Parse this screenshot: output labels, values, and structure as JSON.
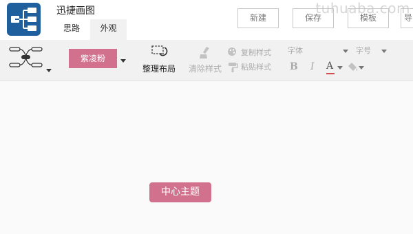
{
  "app": {
    "title": "迅捷画图"
  },
  "tabs": [
    {
      "label": "思路"
    },
    {
      "label": "外观"
    }
  ],
  "actions": {
    "new_label": "新建",
    "save_label": "保存",
    "template_label": "模板",
    "more_label": "导"
  },
  "watermark": {
    "text": "tuhuaba.com"
  },
  "toolbar": {
    "theme_label": "紫凌粉",
    "layout_label": "整理布局",
    "clear_style_label": "清除样式",
    "copy_style_label": "复制样式",
    "paste_style_label": "粘贴样式",
    "font_label": "字体",
    "font_size_label": "字号",
    "bold_label": "B",
    "italic_label": "I",
    "font_color_label": "A"
  },
  "canvas": {
    "central_topic": "中心主题"
  },
  "colors": {
    "accent_pink": "#d1718e",
    "logo_blue": "#1f5f9e"
  }
}
